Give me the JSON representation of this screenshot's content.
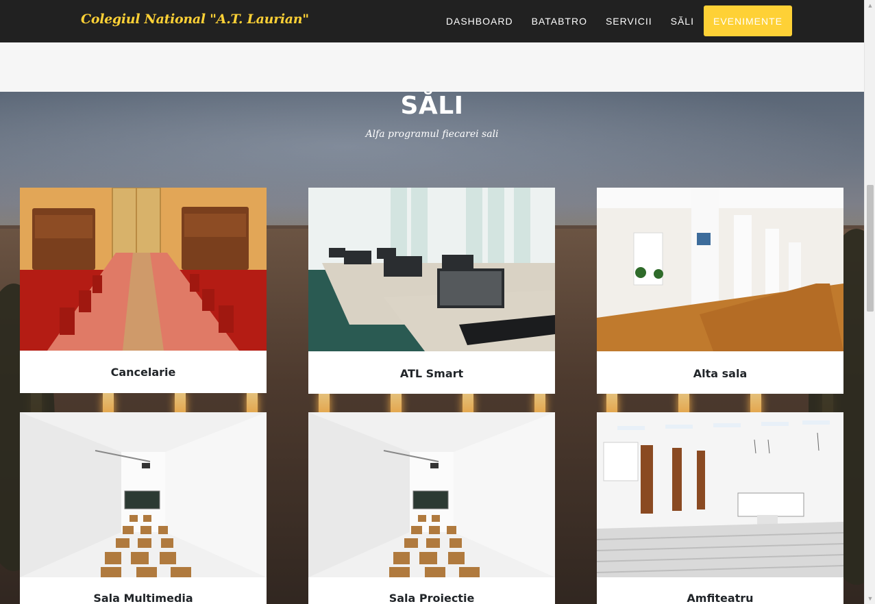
{
  "nav": {
    "brand": "Colegiul National \"A.T. Laurian\"",
    "links": [
      "DASHBOARD",
      "BATABTRO",
      "SERVICII",
      "SĂLI"
    ],
    "cta": "EVENIMENTE"
  },
  "section": {
    "title": "SĂLI",
    "subtitle": "Alfa programul fiecarei sali"
  },
  "rooms": [
    {
      "name": "Cancelarie"
    },
    {
      "name": "ATL Smart"
    },
    {
      "name": "Alta sala"
    },
    {
      "name": "Sala Multimedia"
    },
    {
      "name": "Sala Proiectie"
    },
    {
      "name": "Amfiteatru"
    }
  ],
  "colors": {
    "nav_bg": "#212121",
    "accent": "#fed136"
  }
}
